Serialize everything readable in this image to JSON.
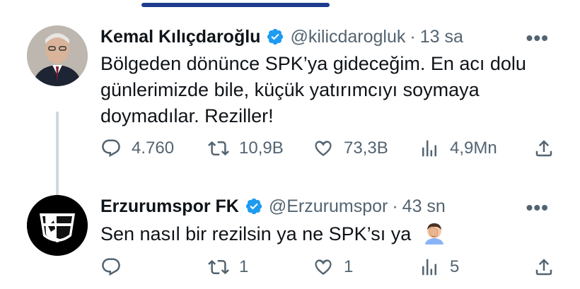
{
  "tweets": [
    {
      "name": "Kemal Kılıçdaroğlu",
      "handle": "@kilicdarogluk",
      "separator": "·",
      "time": "13 sa",
      "more": "•••",
      "text": "Bölgeden dönünce SPK’ya gideceğim. En acı dolu günlerimizde bile, küçük yatırımcıyı soymaya doymadılar. Reziller!",
      "counts": {
        "reply": "4.760",
        "retweet": "10,9B",
        "like": "73,3B",
        "views": "4,9Mn"
      }
    },
    {
      "name": "Erzurumspor FK",
      "handle": "@Erzurumspor",
      "separator": "·",
      "time": "43 sn",
      "more": "•••",
      "text": "Sen nasıl bir rezilsin ya ne SPK’sı ya",
      "emoji": "face-palm-emoji",
      "counts": {
        "reply": "",
        "retweet": "1",
        "like": "1",
        "views": "5"
      }
    }
  ],
  "colors": {
    "text": "#0f1419",
    "muted": "#536471",
    "verified": "#1d9bf0",
    "thread_line": "#cfd9de"
  },
  "icons": [
    "reply-icon",
    "retweet-icon",
    "like-icon",
    "views-icon",
    "share-icon",
    "verified-badge-icon",
    "more-icon"
  ]
}
